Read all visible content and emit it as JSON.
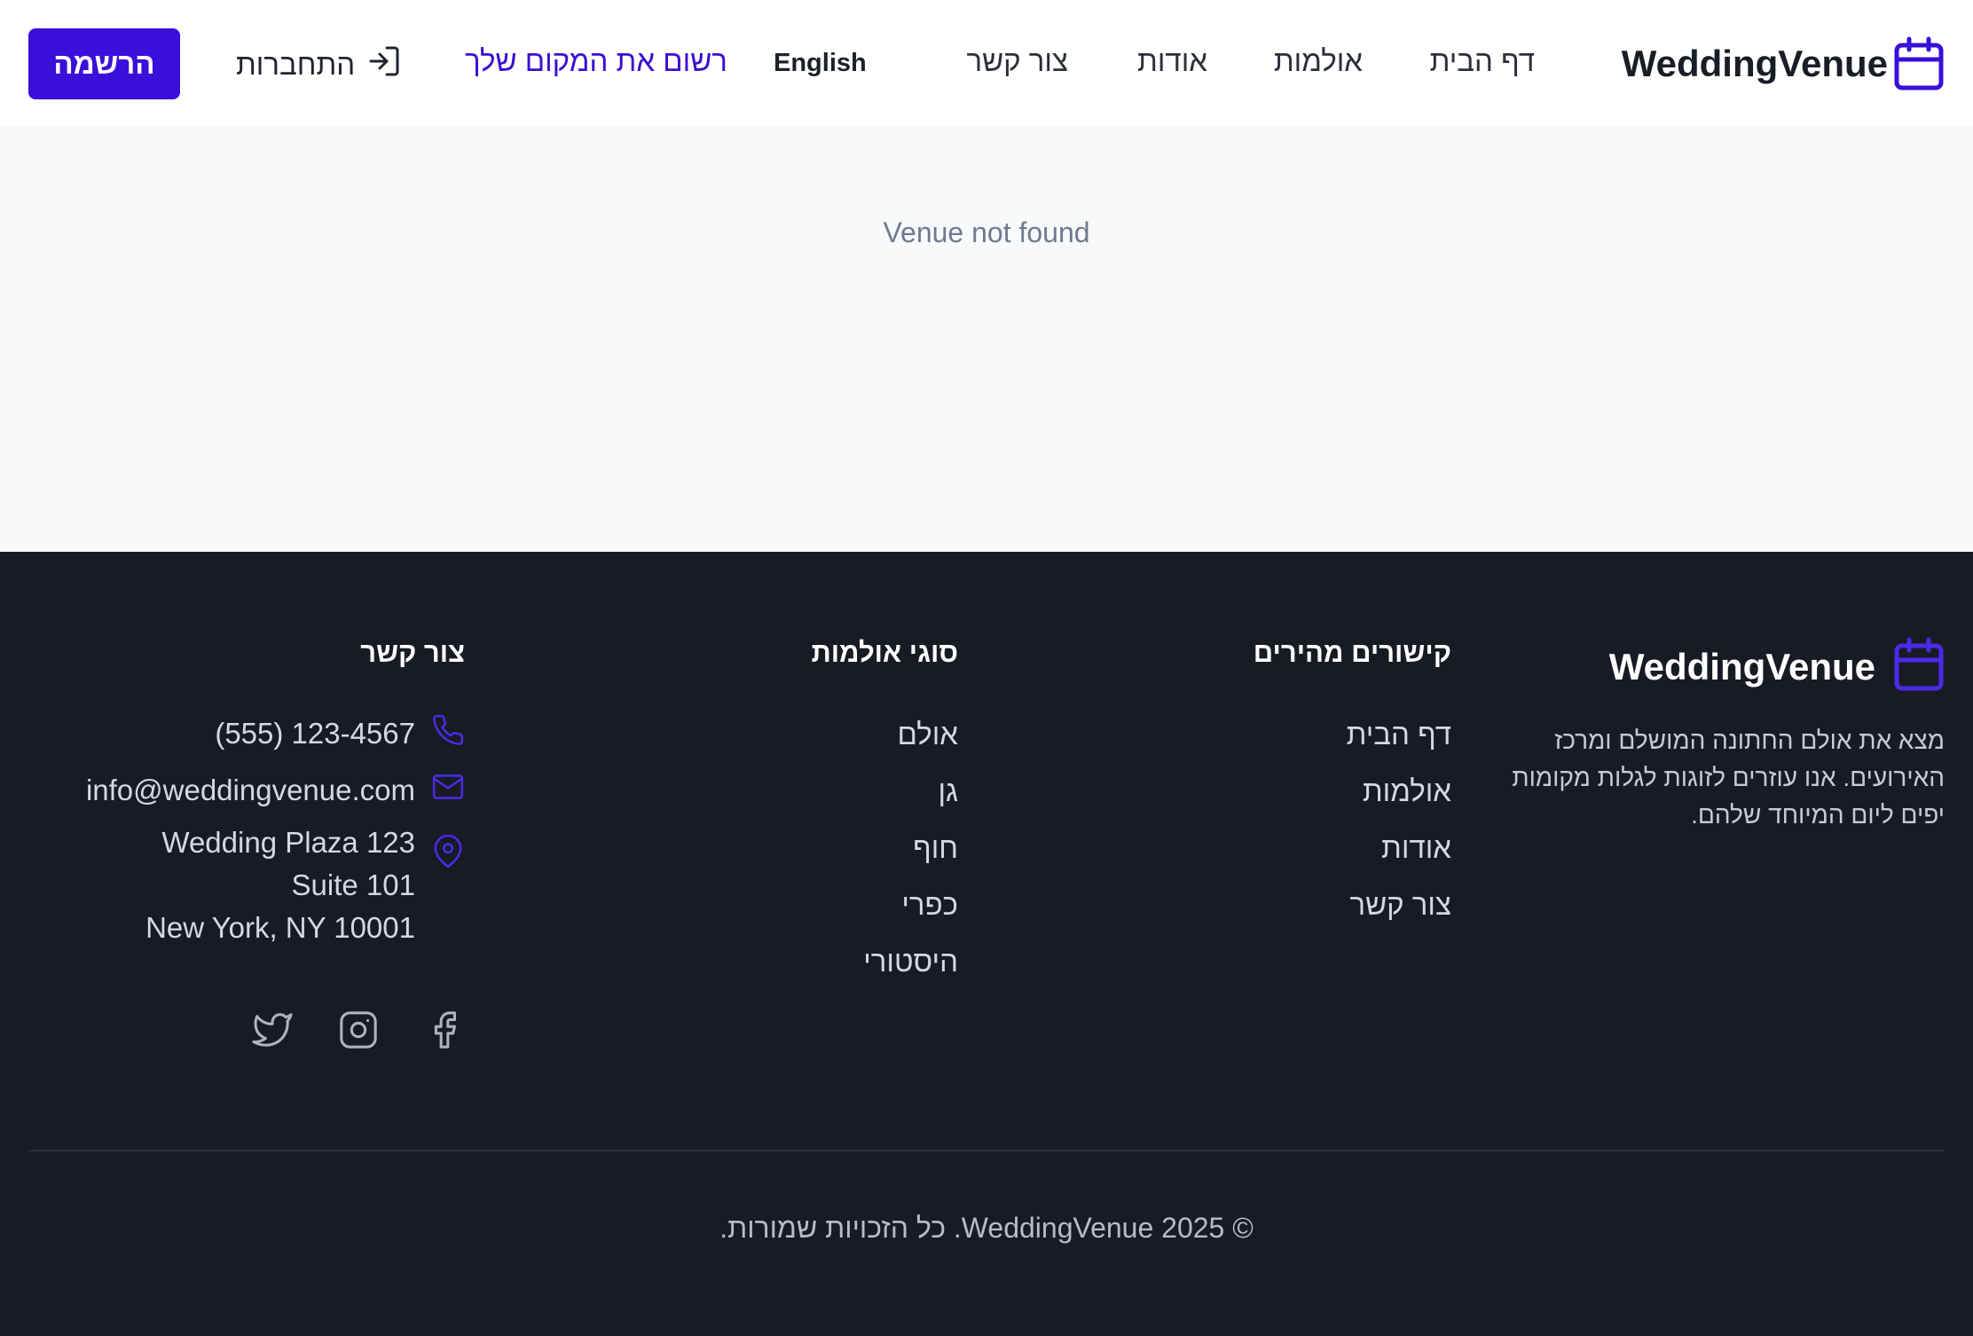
{
  "header": {
    "brand": "WeddingVenue",
    "nav": [
      "דף הבית",
      "אולמות",
      "אודות",
      "צור קשר"
    ],
    "language": "English",
    "list_venue": "רשום את המקום שלך",
    "login": "התחברות",
    "signup": "הרשמה"
  },
  "main": {
    "message": "Venue not found"
  },
  "footer": {
    "brand": "WeddingVenue",
    "description": "מצא את אולם החתונה המושלם ומרכז האירועים. אנו עוזרים לזוגות לגלות מקומות יפים ליום המיוחד שלהם.",
    "quick_links": {
      "title": "קישורים מהירים",
      "items": [
        "דף הבית",
        "אולמות",
        "אודות",
        "צור קשר"
      ]
    },
    "venue_types": {
      "title": "סוגי אולמות",
      "items": [
        "אולם",
        "גן",
        "חוף",
        "כפרי",
        "היסטורי"
      ]
    },
    "contact": {
      "title": "צור קשר",
      "phone": "(555) 123-4567",
      "email": "info@weddingvenue.com",
      "address": [
        "Wedding Plaza 123",
        "Suite 101",
        "New York, NY 10001"
      ]
    },
    "social": [
      "facebook-icon",
      "instagram-icon",
      "twitter-icon"
    ],
    "copyright": "© WeddingVenue 2025. כל הזכויות שמורות."
  },
  "colors": {
    "accent": "#3a0fd9",
    "footer_bg": "#181b24",
    "page_bg": "#f8f9fb"
  }
}
